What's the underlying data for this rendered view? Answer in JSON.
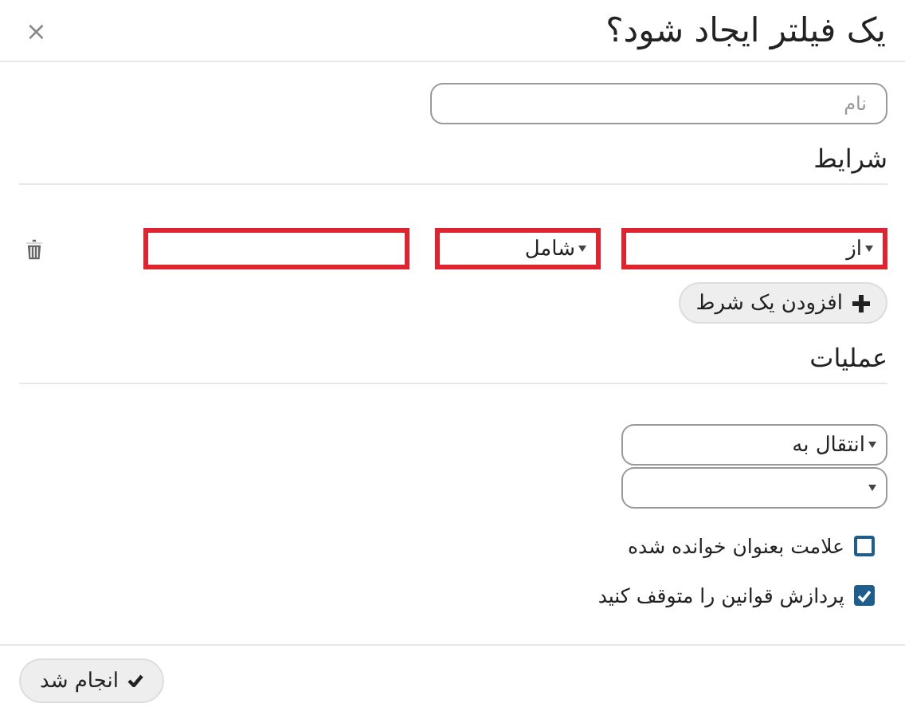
{
  "dialog": {
    "title": "یک فیلتر ایجاد شود؟",
    "close": "×"
  },
  "name_field": {
    "placeholder": "نام"
  },
  "conditions": {
    "heading": "شرایط",
    "rows": [
      {
        "field": "از",
        "operator": "شامل",
        "invalid": true
      }
    ],
    "add_button": "افزودن یک شرط"
  },
  "actions": {
    "heading": "عملیات",
    "selects": [
      {
        "kind": "dropdown",
        "value": "انتقال به"
      },
      {
        "kind": "dropdown"
      }
    ],
    "checkboxes": [
      {
        "label": "علامت بعنوان خوانده شده",
        "checked": false
      },
      {
        "label": "پردازش قوانین را متوقف کنید",
        "checked": true
      }
    ]
  },
  "footer": {
    "done_button": "انجام شد"
  }
}
